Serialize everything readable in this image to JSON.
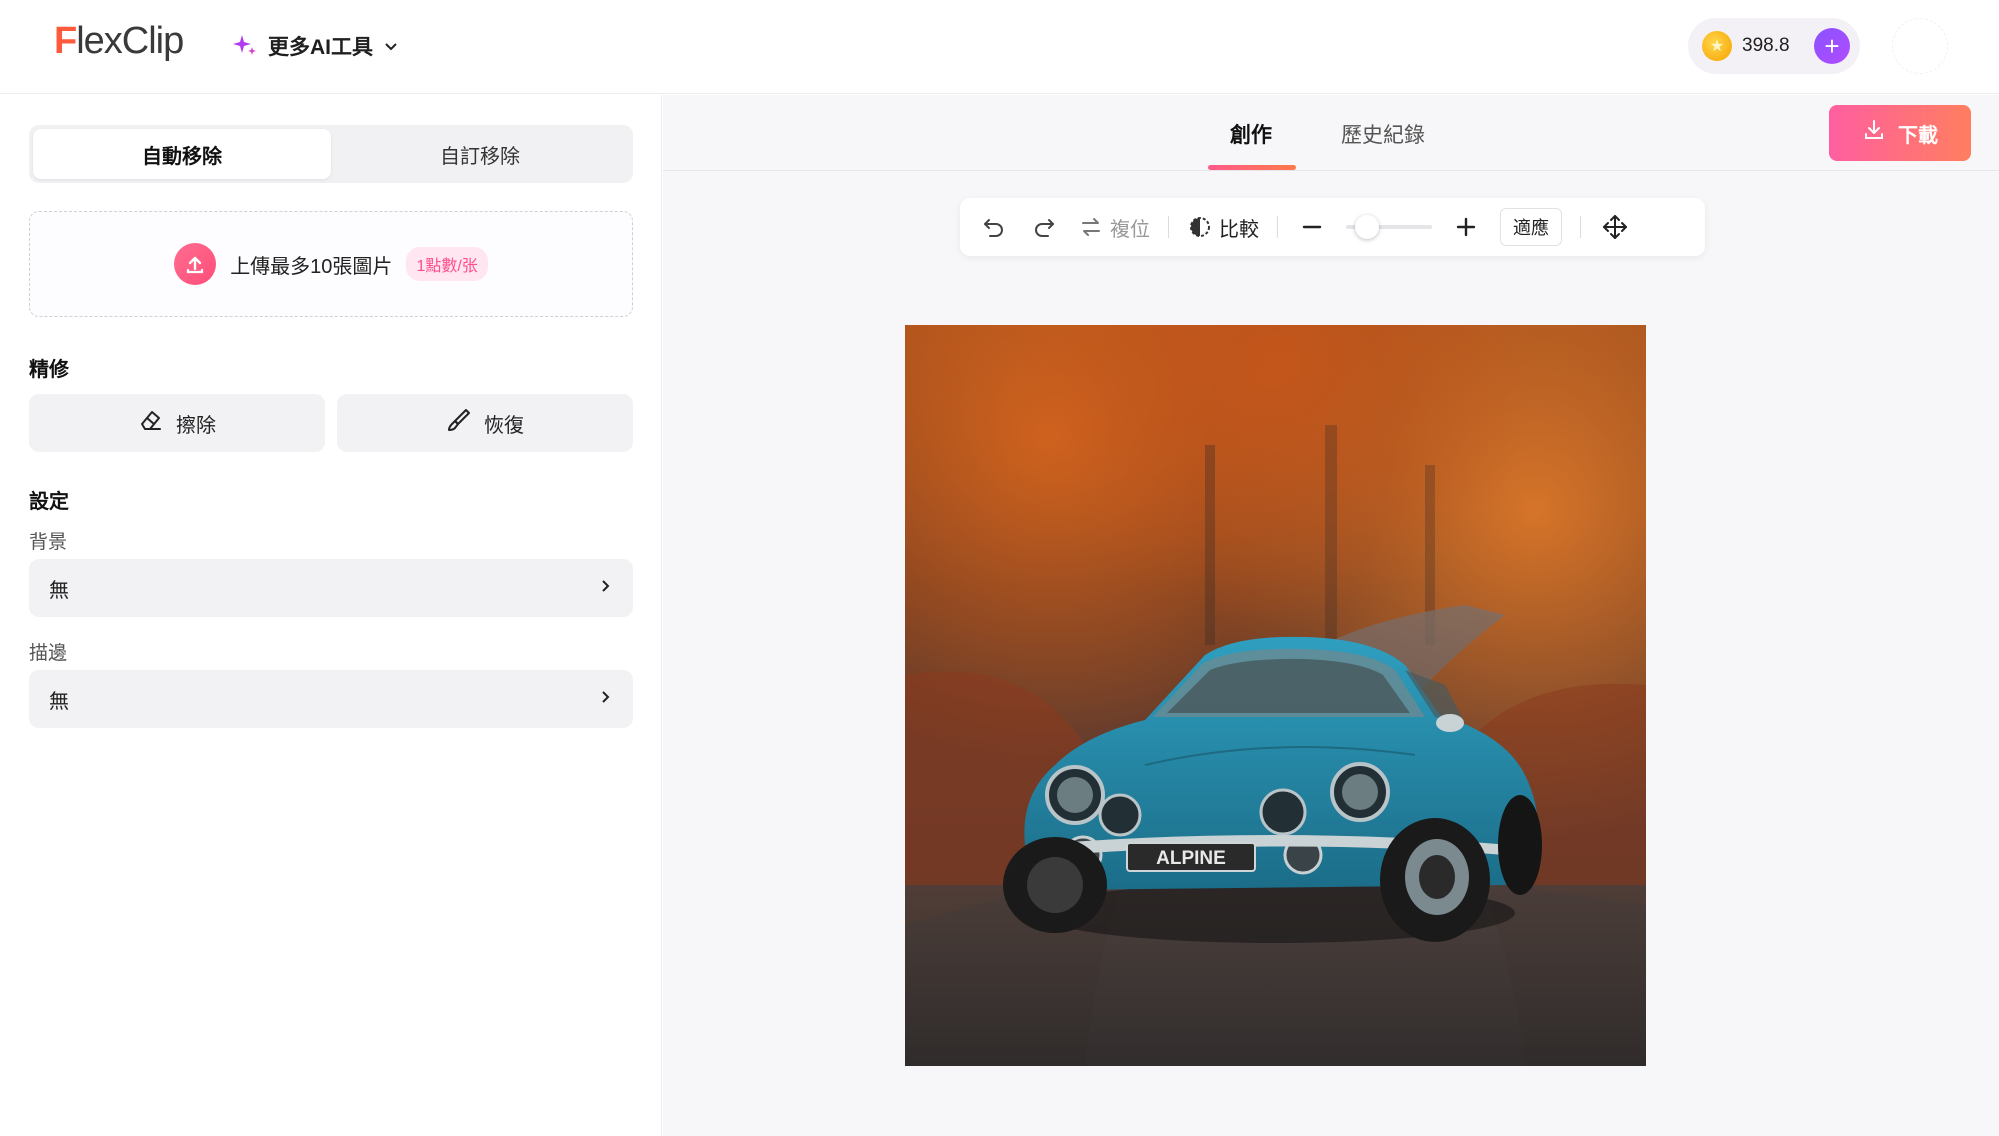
{
  "header": {
    "logo_first": "F",
    "logo_rest": "lexClip",
    "ai_tools_label": "更多AI工具",
    "credits": "398.8"
  },
  "left_panel": {
    "mode_tabs": [
      {
        "label": "自動移除",
        "active": true
      },
      {
        "label": "自訂移除",
        "active": false
      }
    ],
    "upload": {
      "label": "上傳最多10張圖片",
      "badge": "1點數/张"
    },
    "refine_title": "精修",
    "erase_label": "擦除",
    "restore_label": "恢復",
    "settings_title": "設定",
    "background": {
      "label": "背景",
      "value": "無"
    },
    "stroke": {
      "label": "描邊",
      "value": "無"
    }
  },
  "main": {
    "view_tabs": [
      {
        "label": "創作",
        "active": true
      },
      {
        "label": "歷史紀錄",
        "active": false
      }
    ],
    "download_label": "下載",
    "toolbar": {
      "reset_label": "複位",
      "compare_label": "比較",
      "fit_label": "適應",
      "zoom_level": 0.15
    },
    "image": {
      "plate_text": "ALPINE"
    }
  },
  "colors": {
    "accent_pink": "#ff5a8a",
    "accent_orange": "#ff7a4a",
    "purple": "#8a52ff",
    "logo_orange": "#ff5a3c"
  }
}
